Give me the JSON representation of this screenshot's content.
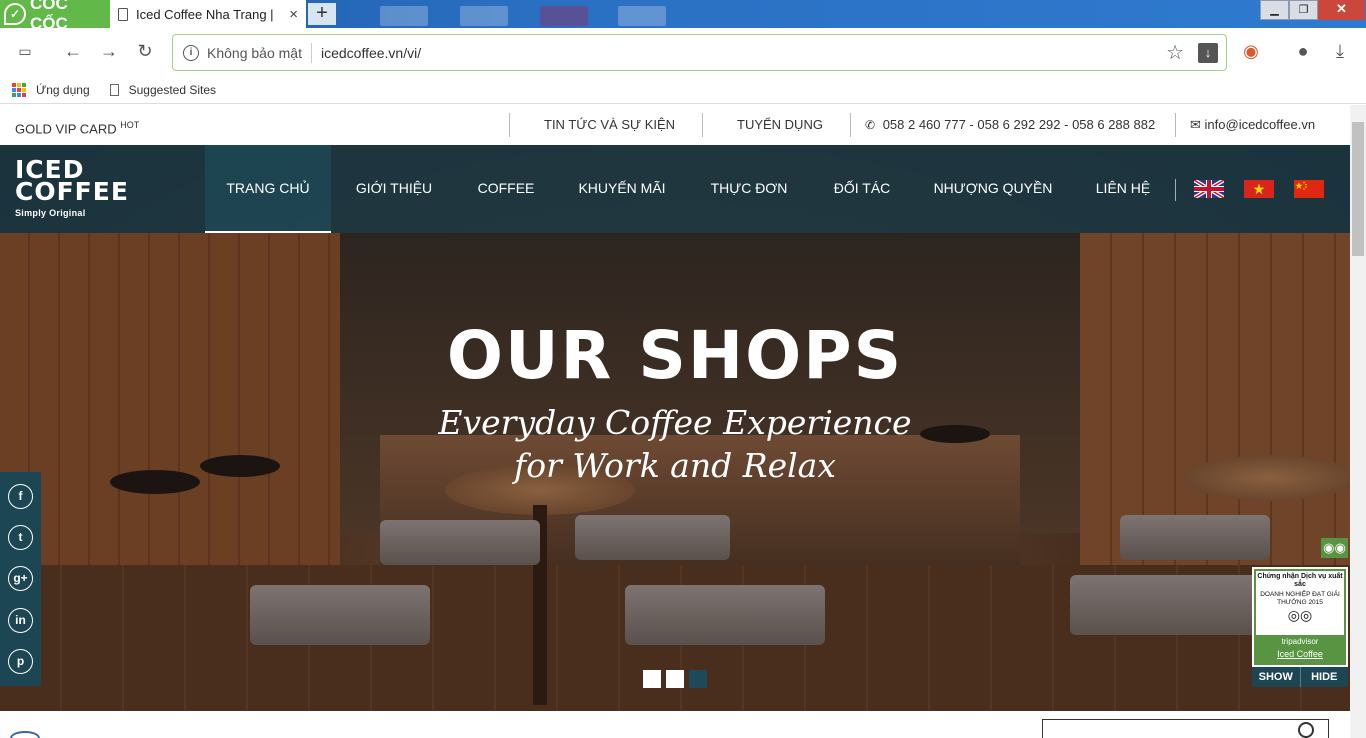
{
  "browser": {
    "brand": "CỐC CỐC",
    "tab_title": "Iced Coffee Nha Trang |",
    "tab_close": "×",
    "new_tab": "+",
    "window_buttons": [
      "▁",
      "❐",
      "✕"
    ],
    "security_label": "Không bảo mật",
    "url": "icedcoffee.vn/vi/",
    "bookmarks": [
      "Ứng dụng",
      "Suggested Sites"
    ]
  },
  "topbar": {
    "gold_vip": "GOLD VIP CARD",
    "hot": "HOT",
    "news": "TIN TỨC VÀ SỰ KIỆN",
    "jobs": "TUYỂN DỤNG",
    "phone": "058 2 460 777 - 058 6 292 292 - 058 6 288 882",
    "email": "info@icedcoffee.vn"
  },
  "logo": {
    "line1": "ICED",
    "line2": "COFFEE",
    "tagline": "Simply Original"
  },
  "nav": {
    "items": [
      "TRANG CHỦ",
      "GIỚI THIỆU",
      "COFFEE",
      "KHUYẾN MÃI",
      "THỰC ĐƠN",
      "ĐỐI TÁC",
      "NHƯỢNG QUYỀN",
      "LIÊN HỆ"
    ],
    "active": "TRANG CHỦ",
    "languages": [
      "en",
      "vi",
      "zh"
    ]
  },
  "hero": {
    "title": "OUR SHOPS",
    "subtitle_line1": "Everyday Coffee Experience",
    "subtitle_line2": "for Work and Relax",
    "slides": 3,
    "active_slide": 3
  },
  "social": [
    "f",
    "t",
    "g+",
    "in",
    "p"
  ],
  "tripadvisor": {
    "line1": "Chứng nhận Dịch vụ xuất sắc",
    "line2": "DOANH NGHIỆP ĐẠT GIẢI THƯỞNG 2015",
    "brand": "tripadvisor",
    "name": "Iced Coffee",
    "show": "SHOW",
    "hide": "HIDE"
  },
  "colors": {
    "nav_bg": "#1d4654",
    "ta_green": "#589442",
    "brand_green": "#63b84a"
  }
}
